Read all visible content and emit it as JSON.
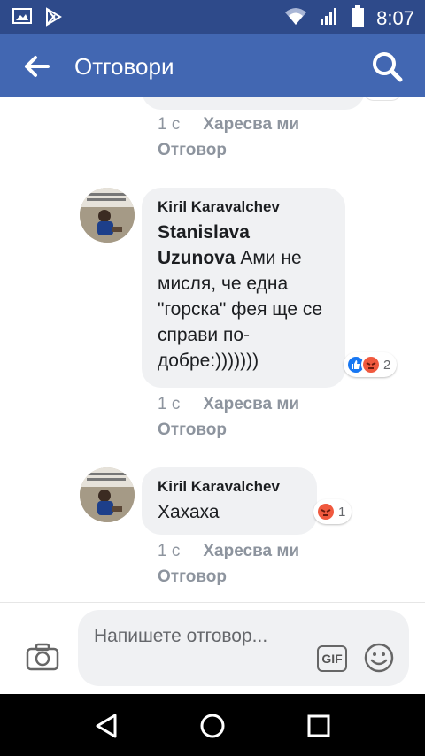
{
  "status_bar": {
    "time": "8:07",
    "icons": [
      "image-icon",
      "play-store-icon",
      "wifi-icon",
      "signal-icon",
      "battery-icon"
    ]
  },
  "app_bar": {
    "title": "Отговори",
    "back_icon": "arrow-left-icon",
    "search_icon": "search-icon",
    "background": "#4267b2"
  },
  "previous_comment": {
    "time": "1 с",
    "like_label": "Харесва ми",
    "reply_label": "Отговор"
  },
  "comments": [
    {
      "author": "Kiril Karavalchev",
      "mention": "Stanislava Uzunova",
      "text": "Ами не мисля, че една \"горска\" фея ще се справи по-добре:)))))))",
      "reactions": [
        "like",
        "angry"
      ],
      "reaction_count": "2",
      "time": "1 с",
      "like_label": "Харесва ми",
      "reply_label": "Отговор"
    },
    {
      "author": "Kiril Karavalchev",
      "text": "Хахаха",
      "reactions": [
        "angry"
      ],
      "reaction_count": "1",
      "time": "1 с",
      "like_label": "Харесва ми",
      "reply_label": "Отговор"
    }
  ],
  "composer": {
    "placeholder": "Напишете отговор...",
    "gif_label": "GIF",
    "camera_icon": "camera-icon",
    "emoji_icon": "emoji-icon"
  },
  "nav_bar": {
    "icons": [
      "back-triangle-icon",
      "home-circle-icon",
      "recents-square-icon"
    ]
  },
  "colors": {
    "status_bar": "#2e4a8a",
    "app_bar": "#4267b2",
    "bubble": "#f0f1f3",
    "meta_text": "#8d949e",
    "like_blue": "#1877f2",
    "angry_orange": "#f0593e"
  }
}
